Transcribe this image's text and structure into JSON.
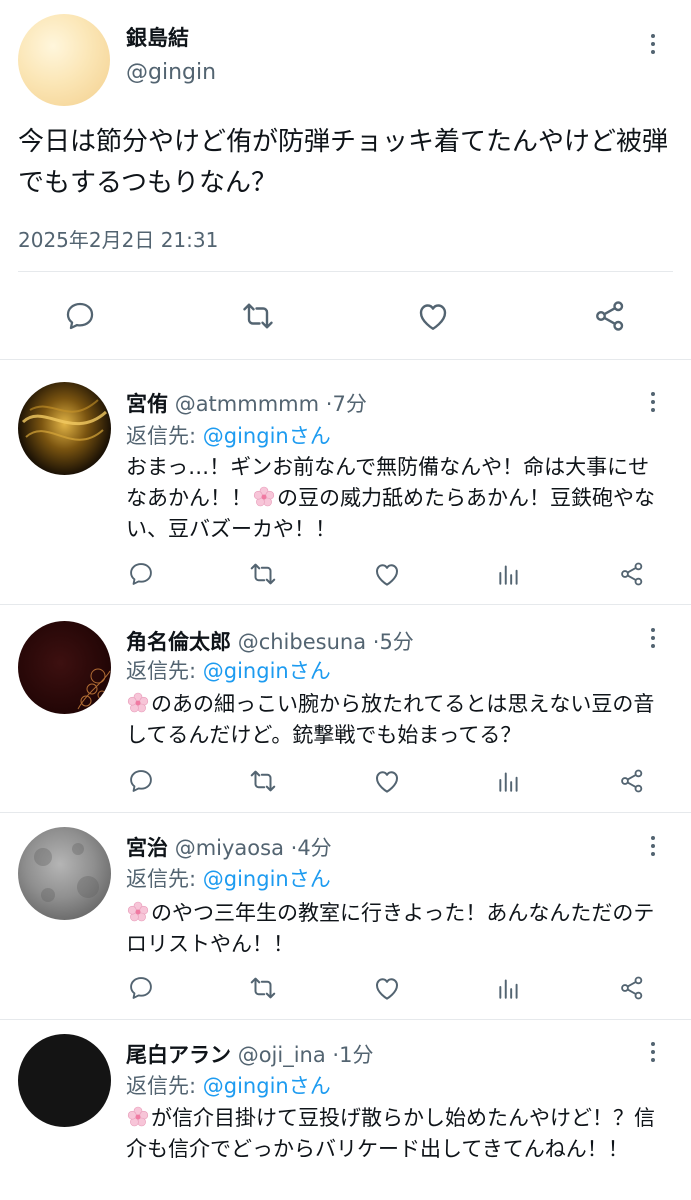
{
  "main_tweet": {
    "name": "銀島結",
    "handle": "@gingin",
    "text": "今日は節分やけど侑が防弾チョッキ着てたんやけど被弾でもするつもりなん？",
    "timestamp": "2025年2月2日 21:31",
    "avatar_color": "#f8dfa8",
    "actions": [
      "reply-icon",
      "retweet-icon",
      "like-icon",
      "share-icon"
    ]
  },
  "replies": [
    {
      "name": "宮侑",
      "handle": "@atmmmmm",
      "separator": "·",
      "time": "7分",
      "reply_prefix": "返信先: ",
      "reply_to": "@ginginさん",
      "has_emoji": false,
      "text_html_parts": [
        "おまっ…！ギンお前なんで無防備なんや！命は大事にせなあかん！！",
        "の豆の威力舐めたらあかん！豆鉄砲やない、豆バズーカや！！"
      ],
      "avatar_color": "#b8860b"
    },
    {
      "name": "角名倫太郎",
      "handle": "@chibesuna",
      "separator": "·",
      "time": "5分",
      "reply_prefix": "返信先: ",
      "reply_to": "@ginginさん",
      "text_html_parts": [
        "",
        "のあの細っこい腕から放たれてるとは思えない豆の音してるんだけど。銃撃戦でも始まってる？"
      ],
      "avatar_color": "#3a0f0f"
    },
    {
      "name": "宮治",
      "handle": "@miyaosa",
      "separator": "·",
      "time": "4分",
      "reply_prefix": "返信先: ",
      "reply_to": "@ginginさん",
      "text_html_parts": [
        "",
        "のやつ三年生の教室に行きよった！あんなんただのテロリストやん！！"
      ],
      "avatar_color": "#8a8a8a"
    },
    {
      "name": "尾白アラン",
      "handle": "@oji_ina",
      "separator": "·",
      "time": "1分",
      "reply_prefix": "返信先: ",
      "reply_to": "@ginginさん",
      "text_html_parts": [
        "",
        "が信介目掛けて豆投げ散らかし始めたんやけど！？信介も信介でどっからバリケード出してきてんねん！！"
      ],
      "avatar_color": "#141414"
    }
  ],
  "reply_actions": [
    "reply-icon",
    "retweet-icon",
    "like-icon",
    "views-icon",
    "share-icon"
  ],
  "colors": {
    "link": "#1d9bf0",
    "secondary": "#536471",
    "icon": "#536471",
    "divider": "#e6e9ec"
  }
}
